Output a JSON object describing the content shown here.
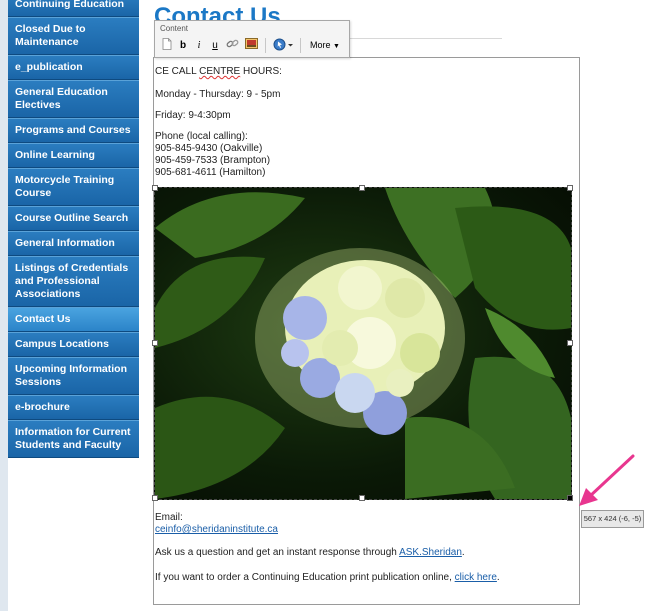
{
  "sidebar": {
    "items": [
      {
        "label": "Continuing Education"
      },
      {
        "label": "Closed Due to Maintenance"
      },
      {
        "label": "e_publication"
      },
      {
        "label": "General Education Electives"
      },
      {
        "label": "Programs and Courses"
      },
      {
        "label": "Online Learning"
      },
      {
        "label": "Motorcycle Training Course"
      },
      {
        "label": "Course Outline Search"
      },
      {
        "label": "General Information"
      },
      {
        "label": "Listings of Credentials and Professional Associations"
      },
      {
        "label": "Contact Us",
        "active": true
      },
      {
        "label": "Campus Locations"
      },
      {
        "label": "Upcoming Information Sessions"
      },
      {
        "label": "e-brochure"
      },
      {
        "label": "Information for Current Students and Faculty"
      }
    ]
  },
  "page": {
    "title": "Contact Us"
  },
  "toolbar": {
    "label": "Content",
    "bold": "b",
    "italic": "i",
    "underline": "u",
    "more": "More"
  },
  "content": {
    "hours_prefix": "CE CALL ",
    "hours_word": "CENTRE",
    "hours_suffix": " HOURS:",
    "weekday": "Monday - Thursday: 9 - 5pm",
    "friday": "Friday: 9-4:30pm",
    "phone_heading": "Phone (local calling):",
    "phone_oakville": "905-845-9430 (Oakville)",
    "phone_brampton": "905-459-7533 (Brampton)",
    "phone_hamilton": "905-681-4611 (Hamilton)",
    "email_label": "Email:",
    "email": "ceinfo@sheridaninstitute.ca",
    "ask_text": "Ask us a question and get an instant response through ",
    "ask_link": "ASK.Sheridan",
    "ask_end": ".",
    "order_text": "If you want to order a Continuing Education print publication online, ",
    "order_link": "click here",
    "order_end": "."
  },
  "image": {
    "size_tip": "567 x 424 (-6, -5)"
  },
  "colors": {
    "accent": "#1b78c6",
    "arrow": "#e8368f",
    "sidebar": "#1c5e98"
  }
}
